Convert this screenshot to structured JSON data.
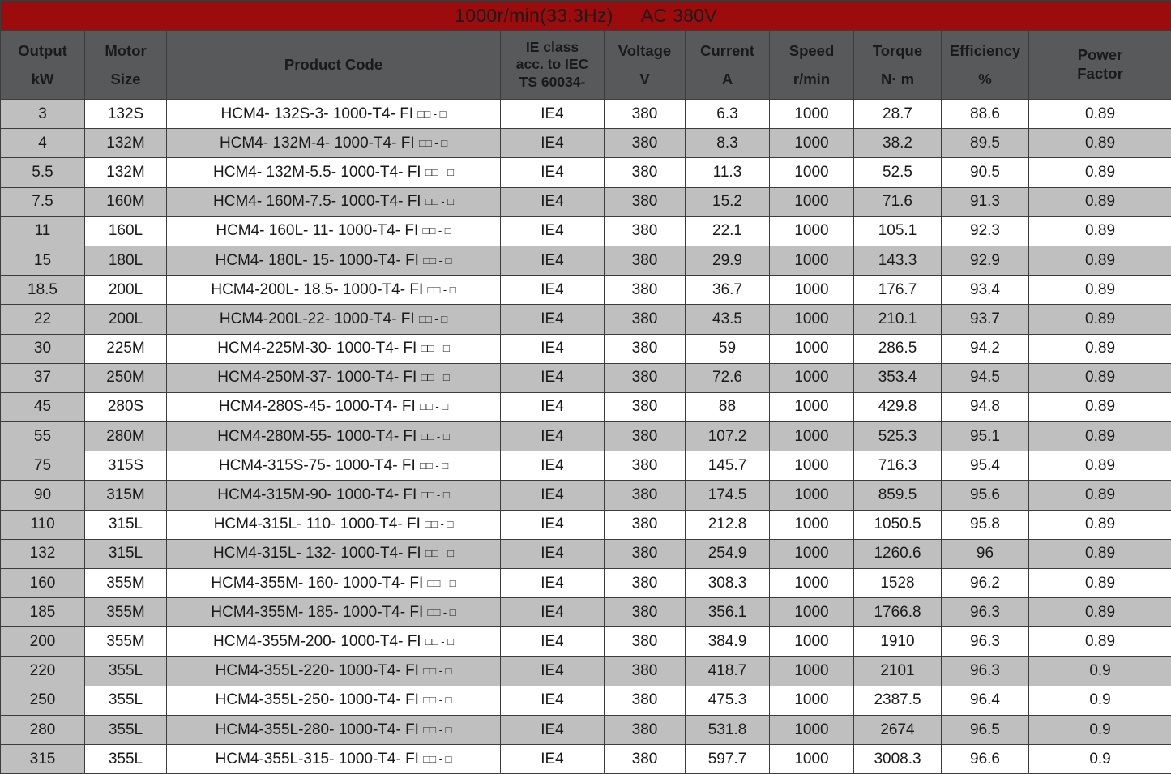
{
  "title": {
    "speed_spec": "1000r/min(33.3Hz)",
    "voltage_spec": "AC 380V"
  },
  "columns": [
    {
      "key": "output",
      "main": "Output",
      "unit": "kW"
    },
    {
      "key": "size",
      "main": "Motor",
      "unit": "Size"
    },
    {
      "key": "code",
      "main": "Product Code",
      "unit": ""
    },
    {
      "key": "ie",
      "main": "IE class",
      "unit": "acc. to IEC",
      "unit2": "TS 60034-"
    },
    {
      "key": "voltage",
      "main": "Voltage",
      "unit": "V"
    },
    {
      "key": "current",
      "main": "Current",
      "unit": "A"
    },
    {
      "key": "speed",
      "main": "Speed",
      "unit": "r/min"
    },
    {
      "key": "torque",
      "main": "Torque",
      "unit": "N· m"
    },
    {
      "key": "efficiency",
      "main": "Efficiency",
      "unit": "%"
    },
    {
      "key": "power_factor",
      "main": "Power",
      "unit": "Factor"
    }
  ],
  "placeholder_suffix": "□□ - □",
  "rows": [
    {
      "output": "3",
      "size": "132S",
      "code": "HCM4- 132S-3- 1000-T4- FI",
      "ie": "IE4",
      "voltage": "380",
      "current": "6.3",
      "speed": "1000",
      "torque": "28.7",
      "efficiency": "88.6",
      "power_factor": "0.89"
    },
    {
      "output": "4",
      "size": "132M",
      "code": "HCM4- 132M-4- 1000-T4- FI",
      "ie": "IE4",
      "voltage": "380",
      "current": "8.3",
      "speed": "1000",
      "torque": "38.2",
      "efficiency": "89.5",
      "power_factor": "0.89"
    },
    {
      "output": "5.5",
      "size": "132M",
      "code": "HCM4- 132M-5.5- 1000-T4- FI",
      "ie": "IE4",
      "voltage": "380",
      "current": "11.3",
      "speed": "1000",
      "torque": "52.5",
      "efficiency": "90.5",
      "power_factor": "0.89"
    },
    {
      "output": "7.5",
      "size": "160M",
      "code": "HCM4- 160M-7.5- 1000-T4- FI",
      "ie": "IE4",
      "voltage": "380",
      "current": "15.2",
      "speed": "1000",
      "torque": "71.6",
      "efficiency": "91.3",
      "power_factor": "0.89"
    },
    {
      "output": "11",
      "size": "160L",
      "code": "HCM4- 160L- 11- 1000-T4- FI",
      "ie": "IE4",
      "voltage": "380",
      "current": "22.1",
      "speed": "1000",
      "torque": "105.1",
      "efficiency": "92.3",
      "power_factor": "0.89"
    },
    {
      "output": "15",
      "size": "180L",
      "code": "HCM4- 180L- 15- 1000-T4- FI",
      "ie": "IE4",
      "voltage": "380",
      "current": "29.9",
      "speed": "1000",
      "torque": "143.3",
      "efficiency": "92.9",
      "power_factor": "0.89"
    },
    {
      "output": "18.5",
      "size": "200L",
      "code": "HCM4-200L- 18.5- 1000-T4- FI",
      "ie": "IE4",
      "voltage": "380",
      "current": "36.7",
      "speed": "1000",
      "torque": "176.7",
      "efficiency": "93.4",
      "power_factor": "0.89"
    },
    {
      "output": "22",
      "size": "200L",
      "code": "HCM4-200L-22- 1000-T4- FI",
      "ie": "IE4",
      "voltage": "380",
      "current": "43.5",
      "speed": "1000",
      "torque": "210.1",
      "efficiency": "93.7",
      "power_factor": "0.89"
    },
    {
      "output": "30",
      "size": "225M",
      "code": "HCM4-225M-30- 1000-T4- FI",
      "ie": "IE4",
      "voltage": "380",
      "current": "59",
      "speed": "1000",
      "torque": "286.5",
      "efficiency": "94.2",
      "power_factor": "0.89"
    },
    {
      "output": "37",
      "size": "250M",
      "code": "HCM4-250M-37- 1000-T4- FI",
      "ie": "IE4",
      "voltage": "380",
      "current": "72.6",
      "speed": "1000",
      "torque": "353.4",
      "efficiency": "94.5",
      "power_factor": "0.89"
    },
    {
      "output": "45",
      "size": "280S",
      "code": "HCM4-280S-45- 1000-T4- FI",
      "ie": "IE4",
      "voltage": "380",
      "current": "88",
      "speed": "1000",
      "torque": "429.8",
      "efficiency": "94.8",
      "power_factor": "0.89"
    },
    {
      "output": "55",
      "size": "280M",
      "code": "HCM4-280M-55- 1000-T4- FI",
      "ie": "IE4",
      "voltage": "380",
      "current": "107.2",
      "speed": "1000",
      "torque": "525.3",
      "efficiency": "95.1",
      "power_factor": "0.89"
    },
    {
      "output": "75",
      "size": "315S",
      "code": "HCM4-315S-75- 1000-T4- FI",
      "ie": "IE4",
      "voltage": "380",
      "current": "145.7",
      "speed": "1000",
      "torque": "716.3",
      "efficiency": "95.4",
      "power_factor": "0.89"
    },
    {
      "output": "90",
      "size": "315M",
      "code": "HCM4-315M-90- 1000-T4- FI",
      "ie": "IE4",
      "voltage": "380",
      "current": "174.5",
      "speed": "1000",
      "torque": "859.5",
      "efficiency": "95.6",
      "power_factor": "0.89"
    },
    {
      "output": "110",
      "size": "315L",
      "code": "HCM4-315L- 110- 1000-T4- FI",
      "ie": "IE4",
      "voltage": "380",
      "current": "212.8",
      "speed": "1000",
      "torque": "1050.5",
      "efficiency": "95.8",
      "power_factor": "0.89"
    },
    {
      "output": "132",
      "size": "315L",
      "code": "HCM4-315L- 132- 1000-T4- FI",
      "ie": "IE4",
      "voltage": "380",
      "current": "254.9",
      "speed": "1000",
      "torque": "1260.6",
      "efficiency": "96",
      "power_factor": "0.89"
    },
    {
      "output": "160",
      "size": "355M",
      "code": "HCM4-355M- 160- 1000-T4- FI",
      "ie": "IE4",
      "voltage": "380",
      "current": "308.3",
      "speed": "1000",
      "torque": "1528",
      "efficiency": "96.2",
      "power_factor": "0.89"
    },
    {
      "output": "185",
      "size": "355M",
      "code": "HCM4-355M- 185- 1000-T4- FI",
      "ie": "IE4",
      "voltage": "380",
      "current": "356.1",
      "speed": "1000",
      "torque": "1766.8",
      "efficiency": "96.3",
      "power_factor": "0.89"
    },
    {
      "output": "200",
      "size": "355M",
      "code": "HCM4-355M-200- 1000-T4- FI",
      "ie": "IE4",
      "voltage": "380",
      "current": "384.9",
      "speed": "1000",
      "torque": "1910",
      "efficiency": "96.3",
      "power_factor": "0.89"
    },
    {
      "output": "220",
      "size": "355L",
      "code": "HCM4-355L-220- 1000-T4- FI",
      "ie": "IE4",
      "voltage": "380",
      "current": "418.7",
      "speed": "1000",
      "torque": "2101",
      "efficiency": "96.3",
      "power_factor": "0.9"
    },
    {
      "output": "250",
      "size": "355L",
      "code": "HCM4-355L-250- 1000-T4- FI",
      "ie": "IE4",
      "voltage": "380",
      "current": "475.3",
      "speed": "1000",
      "torque": "2387.5",
      "efficiency": "96.4",
      "power_factor": "0.9"
    },
    {
      "output": "280",
      "size": "355L",
      "code": "HCM4-355L-280- 1000-T4- FI",
      "ie": "IE4",
      "voltage": "380",
      "current": "531.8",
      "speed": "1000",
      "torque": "2674",
      "efficiency": "96.5",
      "power_factor": "0.9"
    },
    {
      "output": "315",
      "size": "355L",
      "code": "HCM4-355L-315- 1000-T4- FI",
      "ie": "IE4",
      "voltage": "380",
      "current": "597.7",
      "speed": "1000",
      "torque": "3008.3",
      "efficiency": "96.6",
      "power_factor": "0.9"
    }
  ],
  "colors": {
    "title_band": "#9c0c0d",
    "header_bg": "#58595b",
    "row_alt": "#bfbfbf",
    "grid_line": "#3c3c3c"
  }
}
